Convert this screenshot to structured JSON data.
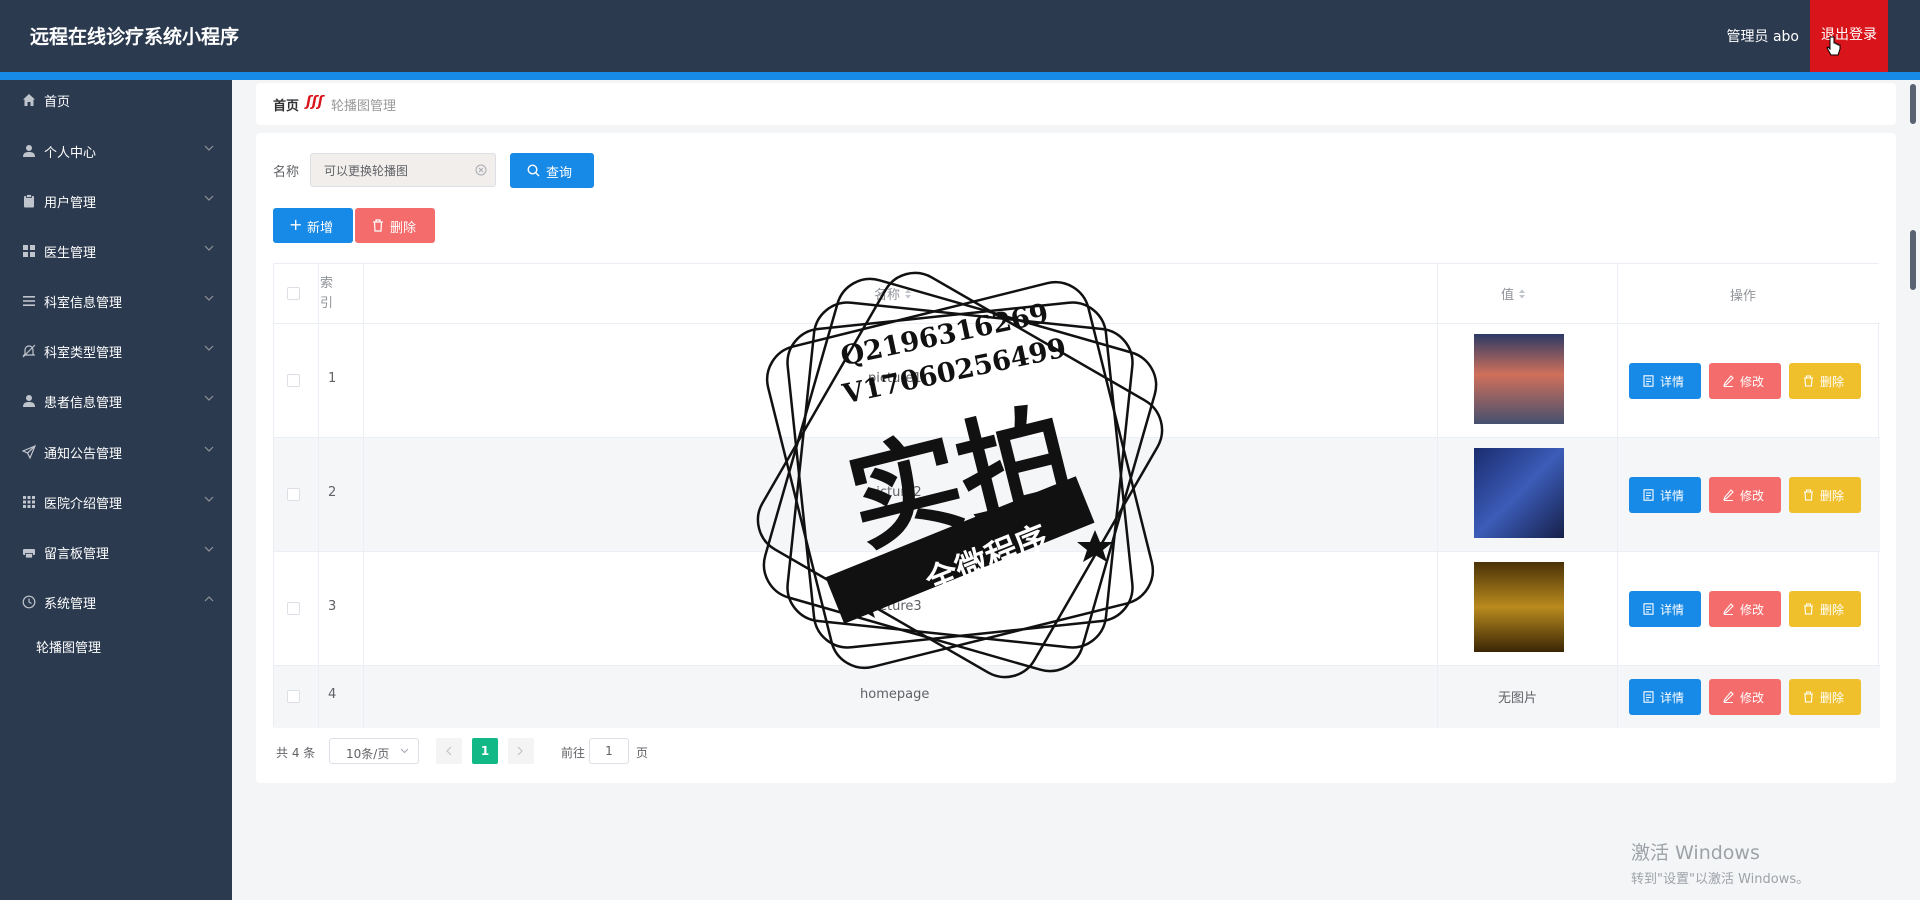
{
  "app": {
    "title": "远程在线诊疗系统小程序",
    "user": "管理员 abo",
    "logout": "退出登录"
  },
  "sidebar": {
    "items": [
      {
        "label": "首页",
        "icon": "home-icon",
        "has_arrow": false
      },
      {
        "label": "个人中心",
        "icon": "user-icon",
        "has_arrow": true
      },
      {
        "label": "用户管理",
        "icon": "clipboard-icon",
        "has_arrow": true
      },
      {
        "label": "医生管理",
        "icon": "grid-icon",
        "has_arrow": true
      },
      {
        "label": "科室信息管理",
        "icon": "list-icon",
        "has_arrow": true
      },
      {
        "label": "科室类型管理",
        "icon": "bell-off-icon",
        "has_arrow": true
      },
      {
        "label": "患者信息管理",
        "icon": "user-icon",
        "has_arrow": true
      },
      {
        "label": "通知公告管理",
        "icon": "send-icon",
        "has_arrow": true
      },
      {
        "label": "医院介绍管理",
        "icon": "apps-icon",
        "has_arrow": true
      },
      {
        "label": "留言板管理",
        "icon": "printer-icon",
        "has_arrow": true
      },
      {
        "label": "系统管理",
        "icon": "clock-icon",
        "has_arrow": true,
        "expanded": true
      }
    ],
    "submenu": [
      {
        "label": "轮播图管理"
      }
    ]
  },
  "breadcrumb": {
    "home": "首页",
    "separator": "ʃʃʃ",
    "current": "轮播图管理"
  },
  "search": {
    "label": "名称",
    "value": "可以更换轮播图",
    "button": "查询"
  },
  "toolbar": {
    "add": "新增",
    "delete": "删除"
  },
  "table": {
    "columns": {
      "index": "索引",
      "name": "名称",
      "value": "值",
      "actions": "操作"
    },
    "rows": [
      {
        "index": "1",
        "name": "picture1",
        "value": "",
        "thumb_colors": [
          "#2c3a66",
          "#d0705a",
          "#45506f"
        ]
      },
      {
        "index": "2",
        "name": "picture2",
        "value": "",
        "thumb_colors": [
          "#1a2c6e",
          "#3c5cb8",
          "#16204a"
        ]
      },
      {
        "index": "3",
        "name": "picture3",
        "value": "",
        "thumb_colors": [
          "#4a3208",
          "#b98a1e",
          "#3a2606"
        ]
      },
      {
        "index": "4",
        "name": "homepage",
        "value": "无图片"
      }
    ],
    "actions": {
      "detail": "详情",
      "edit": "修改",
      "delete": "删除"
    }
  },
  "pagination": {
    "total": "共 4 条",
    "page_size": "10条/页",
    "current_page": "1",
    "goto_prefix": "前往",
    "goto_value": "1",
    "goto_suffix": "页"
  },
  "watermark": {
    "line1": "Q2196316269",
    "line2": "V17060256499",
    "big": "实拍",
    "banner": "全微程序"
  },
  "windows_activation": {
    "line1": "激活 Windows",
    "line2": "转到\"设置\"以激活 Windows。"
  },
  "colors": {
    "topbar": "#2b3a4f",
    "accent": "#1789e6",
    "logout": "#d9141a",
    "primary": "#1789e6",
    "danger": "#f56c6c",
    "warning": "#f0c02c",
    "pager_active": "#12b986"
  }
}
